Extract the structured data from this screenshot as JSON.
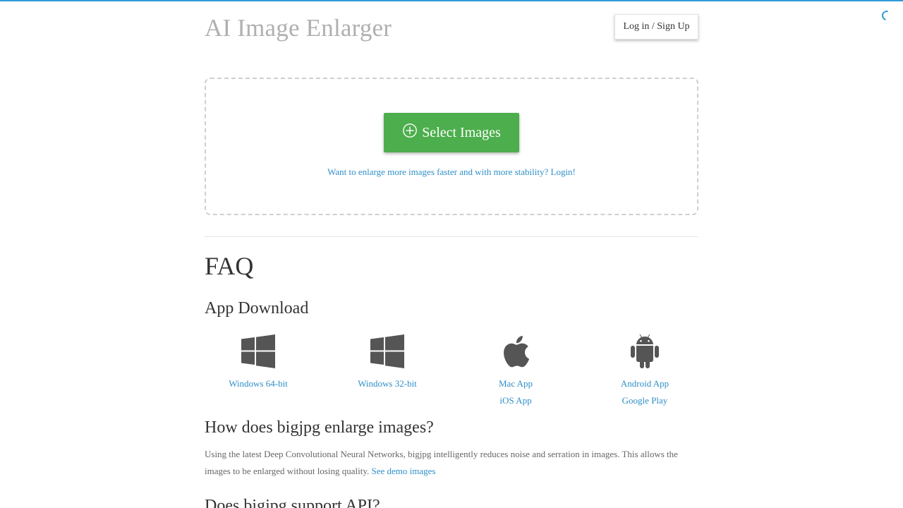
{
  "header": {
    "title": "AI Image Enlarger",
    "login_label": "Log in / Sign Up"
  },
  "upload": {
    "select_label": "Select Images",
    "login_prompt": "Want to enlarge more images faster and with more stability? Login!"
  },
  "faq": {
    "title": "FAQ",
    "app_download": {
      "title": "App Download",
      "apps": [
        {
          "icon": "windows-icon",
          "links": [
            "Windows 64-bit"
          ]
        },
        {
          "icon": "windows-icon",
          "links": [
            "Windows 32-bit"
          ]
        },
        {
          "icon": "apple-icon",
          "links": [
            "Mac App",
            "iOS App"
          ]
        },
        {
          "icon": "android-icon",
          "links": [
            "Android App",
            "Google Play"
          ]
        }
      ]
    },
    "how": {
      "title": "How does bigjpg enlarge images?",
      "text": "Using the latest Deep Convolutional Neural Networks, bigjpg intelligently reduces noise and serration in images. This allows the images to be enlarged without losing quality.",
      "demo_link": "See demo images"
    },
    "api": {
      "title": "Does bigjpg support API?"
    }
  },
  "colors": {
    "accent": "#2e8fc8",
    "button_green": "#4cae4c",
    "title_gray": "#b0b0b0"
  }
}
